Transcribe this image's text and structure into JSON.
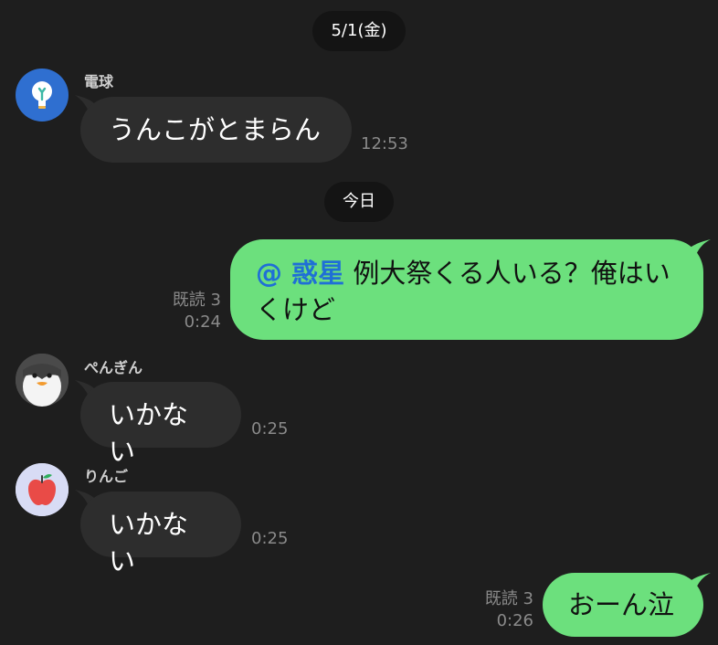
{
  "date_separators": [
    "5/1(金)",
    "今日"
  ],
  "messages": [
    {
      "sender": "電球",
      "avatar_icon": "lightbulb-icon",
      "text": "うんこがとまらん",
      "time": "12:53",
      "direction": "incoming"
    },
    {
      "mention": "@ 惑星",
      "text_line1": " 例大祭くる人いる？俺はい",
      "text_line2": "くけど",
      "read_status": "既読 3",
      "time": "0:24",
      "direction": "outgoing"
    },
    {
      "sender": "ぺんぎん",
      "avatar_icon": "penguin-icon",
      "text": "いかない",
      "time": "0:25",
      "direction": "incoming"
    },
    {
      "sender": "りんご",
      "avatar_icon": "apple-icon",
      "text": "いかない",
      "time": "0:25",
      "direction": "incoming"
    },
    {
      "text": "おーん泣",
      "read_status": "既読 3",
      "time": "0:26",
      "direction": "outgoing"
    }
  ],
  "colors": {
    "background": "#1e1e1e",
    "incoming_bubble": "#2d2d2d",
    "outgoing_bubble": "#6ce07d",
    "mention": "#1f6fd6",
    "date_pill": "#141414"
  }
}
